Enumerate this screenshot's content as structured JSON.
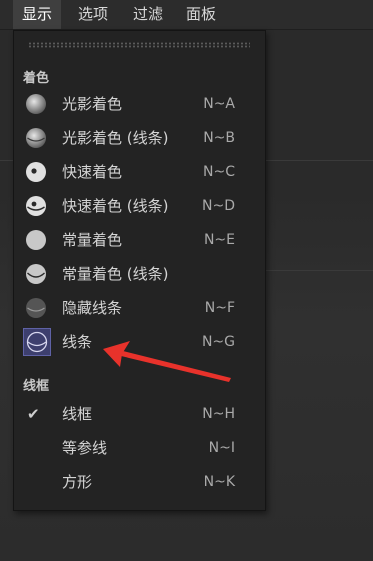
{
  "menubar": {
    "items": [
      "显示",
      "选项",
      "过滤",
      "面板"
    ]
  },
  "menu": {
    "section_shading": "着色",
    "section_wireframe": "线框",
    "items": [
      {
        "label": "光影着色",
        "shortcut": "N~A",
        "icon": "gouraud-shading-icon"
      },
      {
        "label": "光影着色 (线条)",
        "shortcut": "N~B",
        "icon": "gouraud-lines-icon"
      },
      {
        "label": "快速着色",
        "shortcut": "N~C",
        "icon": "quick-shading-icon"
      },
      {
        "label": "快速着色 (线条)",
        "shortcut": "N~D",
        "icon": "quick-lines-icon"
      },
      {
        "label": "常量着色",
        "shortcut": "N~E",
        "icon": "constant-shading-icon"
      },
      {
        "label": "常量着色 (线条)",
        "shortcut": "",
        "icon": "constant-lines-icon"
      },
      {
        "label": "隐藏线条",
        "shortcut": "N~F",
        "icon": "hidden-line-icon"
      },
      {
        "label": "线条",
        "shortcut": "N~G",
        "icon": "lines-icon"
      }
    ],
    "wire_items": [
      {
        "label": "线框",
        "shortcut": "N~H",
        "checked": "✔"
      },
      {
        "label": "等参线",
        "shortcut": "N~I"
      },
      {
        "label": "方形",
        "shortcut": "N~K"
      }
    ]
  },
  "colors": {
    "accent_selection": "#3d3f6e",
    "annotation_arrow": "#e8322b"
  }
}
